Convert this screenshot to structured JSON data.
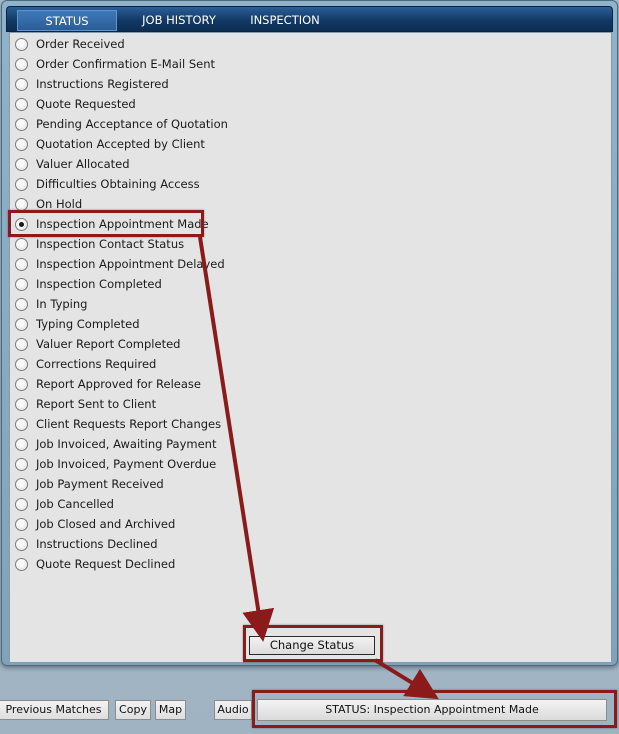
{
  "tabs": [
    {
      "label": "STATUS",
      "active": true
    },
    {
      "label": "JOB HISTORY",
      "active": false
    },
    {
      "label": "INSPECTION",
      "active": false
    }
  ],
  "statuses": [
    {
      "label": "Order Received",
      "selected": false
    },
    {
      "label": "Order Confirmation E-Mail Sent",
      "selected": false
    },
    {
      "label": "Instructions Registered",
      "selected": false
    },
    {
      "label": "Quote Requested",
      "selected": false
    },
    {
      "label": "Pending Acceptance of Quotation",
      "selected": false
    },
    {
      "label": "Quotation Accepted by Client",
      "selected": false
    },
    {
      "label": "Valuer Allocated",
      "selected": false
    },
    {
      "label": "Difficulties Obtaining Access",
      "selected": false
    },
    {
      "label": "On Hold",
      "selected": false
    },
    {
      "label": "Inspection Appointment Made",
      "selected": true
    },
    {
      "label": "Inspection Contact Status",
      "selected": false
    },
    {
      "label": "Inspection Appointment Delayed",
      "selected": false
    },
    {
      "label": "Inspection Completed",
      "selected": false
    },
    {
      "label": "In Typing",
      "selected": false
    },
    {
      "label": "Typing Completed",
      "selected": false
    },
    {
      "label": "Valuer Report Completed",
      "selected": false
    },
    {
      "label": "Corrections Required",
      "selected": false
    },
    {
      "label": "Report Approved for Release",
      "selected": false
    },
    {
      "label": "Report Sent to Client",
      "selected": false
    },
    {
      "label": "Client Requests Report Changes",
      "selected": false
    },
    {
      "label": "Job Invoiced, Awaiting Payment",
      "selected": false
    },
    {
      "label": "Job Invoiced, Payment Overdue",
      "selected": false
    },
    {
      "label": "Job Payment Received",
      "selected": false
    },
    {
      "label": "Job Cancelled",
      "selected": false
    },
    {
      "label": "Job Closed and Archived",
      "selected": false
    },
    {
      "label": "Instructions Declined",
      "selected": false
    },
    {
      "label": "Quote Request Declined",
      "selected": false
    }
  ],
  "change_status_label": "Change Status",
  "toolbar": {
    "previous_matches_label": "Previous Matches",
    "copy_label": "Copy",
    "map_label": "Map",
    "audio_label": "Audio"
  },
  "status_display": "STATUS: Inspection Appointment Made",
  "colors": {
    "tab_bar": "#123a66",
    "panel_background": "#e4e4e4",
    "annotation": "#8b1a1a"
  }
}
